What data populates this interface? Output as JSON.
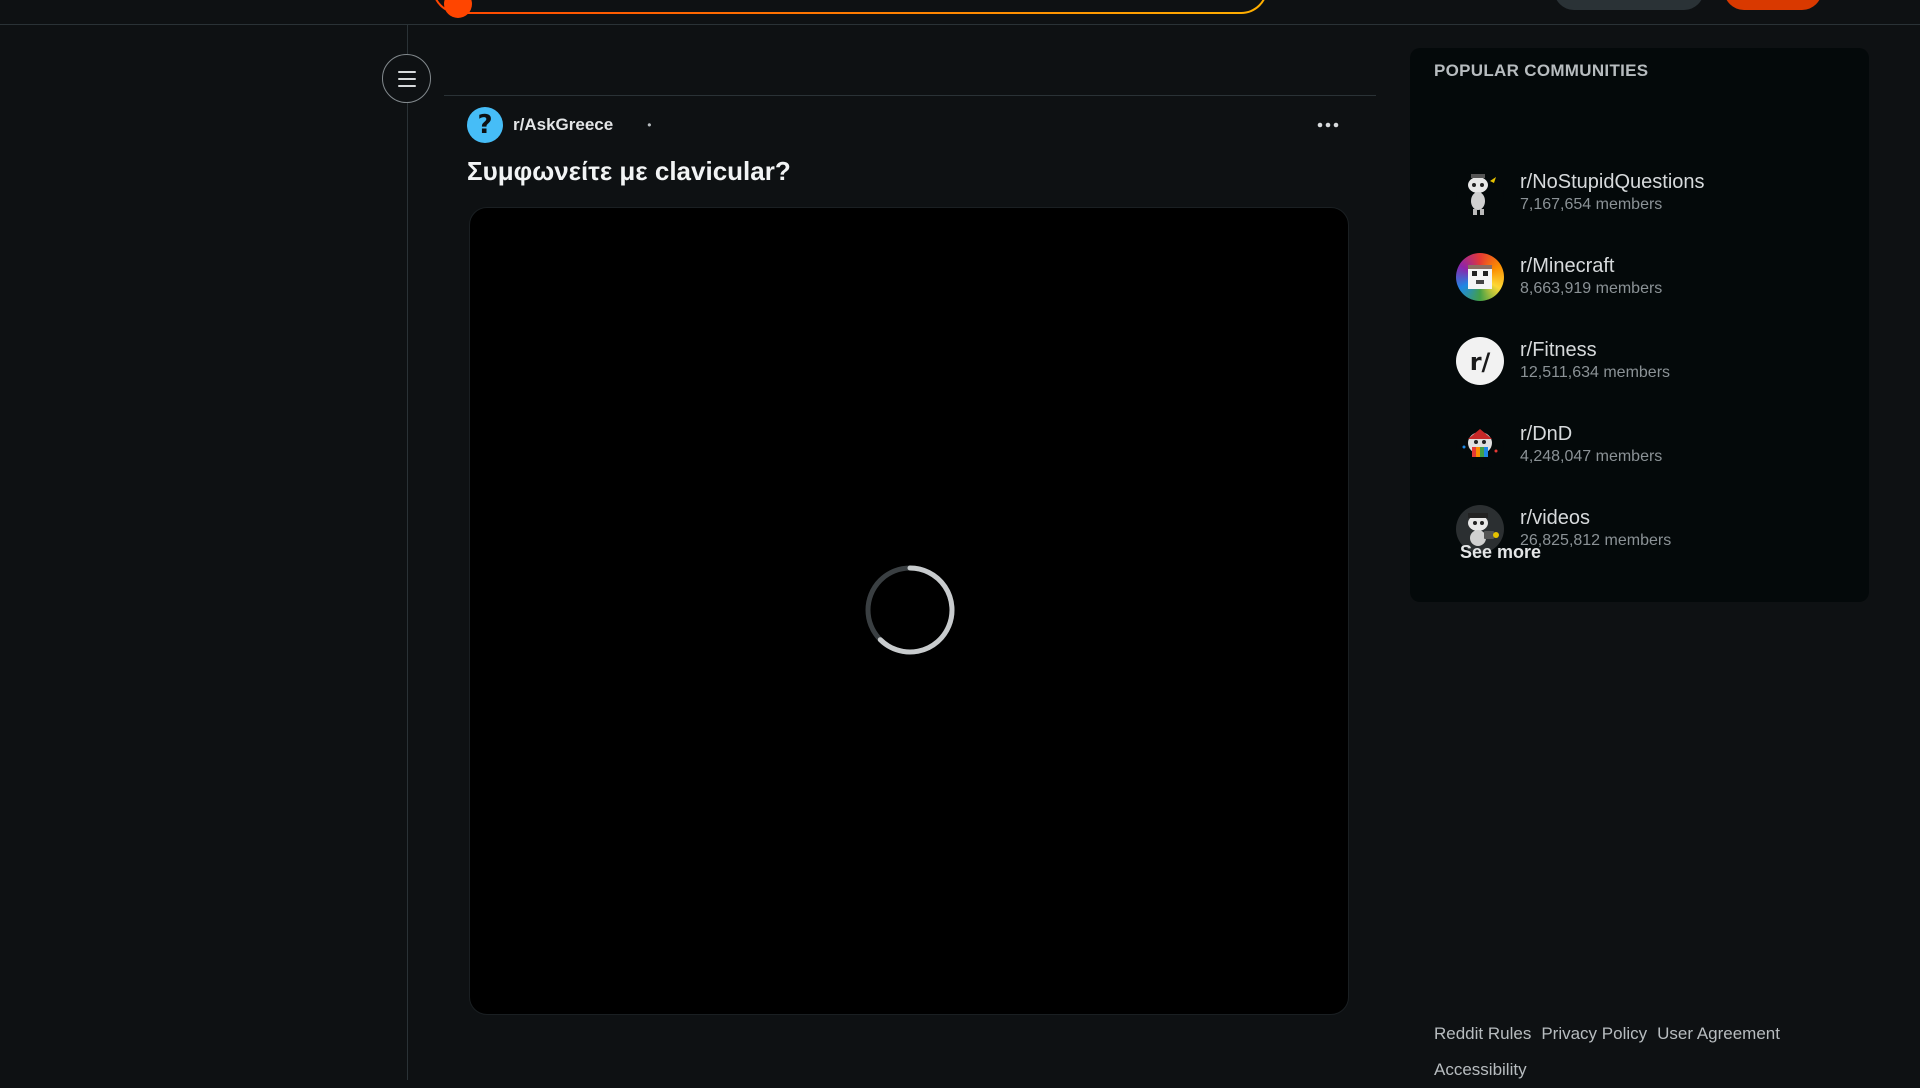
{
  "header": {
    "search_placeholder": ""
  },
  "post": {
    "subreddit": "r/AskGreece",
    "meta_separator": "•",
    "title": "Συμφωνείτε με clavicular?"
  },
  "popular_communities": {
    "heading": "POPULAR COMMUNITIES",
    "items": [
      {
        "name": "r/NoStupidQuestions",
        "members": "7,167,654 members",
        "icon": "snoo-thinking-icon"
      },
      {
        "name": "r/Minecraft",
        "members": "8,663,919 members",
        "icon": "minecraft-icon"
      },
      {
        "name": "r/Fitness",
        "members": "12,511,634 members",
        "icon": "reddit-r-icon"
      },
      {
        "name": "r/DnD",
        "members": "4,248,047 members",
        "icon": "dnd-snoo-icon"
      },
      {
        "name": "r/videos",
        "members": "26,825,812 members",
        "icon": "snoo-camera-icon"
      }
    ],
    "see_more": "See more"
  },
  "footer": {
    "rules": "Reddit Rules",
    "privacy": "Privacy Policy",
    "agreement": "User Agreement",
    "accessibility": "Accessibility"
  },
  "colors": {
    "background": "#0e1113",
    "panel": "#04090a",
    "brand_orange": "#ff4500",
    "askgreece_blue": "#46bdf7"
  }
}
